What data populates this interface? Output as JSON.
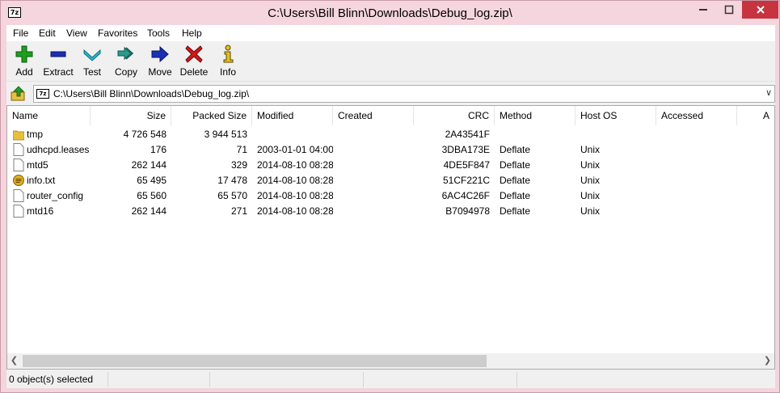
{
  "window": {
    "title": "C:\\Users\\Bill Blinn\\Downloads\\Debug_log.zip\\",
    "app_icon_text": "7z"
  },
  "window_controls": {
    "minimize": "▭",
    "maximize": "☐",
    "close": "✕"
  },
  "menu": [
    "File",
    "Edit",
    "View",
    "Favorites",
    "Tools",
    "Help"
  ],
  "toolbar": [
    {
      "label": "Add",
      "icon": "plus-icon",
      "color": "#1e9e1e"
    },
    {
      "label": "Extract",
      "icon": "minus-icon",
      "color": "#1a2fb5"
    },
    {
      "label": "Test",
      "icon": "check-chevron-icon",
      "color": "#2ab5c9"
    },
    {
      "label": "Copy",
      "icon": "double-arrow-icon",
      "color": "#2a9a8a"
    },
    {
      "label": "Move",
      "icon": "right-arrow-icon",
      "color": "#1a2fb5"
    },
    {
      "label": "Delete",
      "icon": "x-icon",
      "color": "#d01818"
    },
    {
      "label": "Info",
      "icon": "info-icon",
      "color": "#e0c020"
    }
  ],
  "address": {
    "path": "C:\\Users\\Bill Blinn\\Downloads\\Debug_log.zip\\",
    "icon_text": "7z"
  },
  "columns": [
    "Name",
    "Size",
    "Packed Size",
    "Modified",
    "Created",
    "CRC",
    "Method",
    "Host OS",
    "Accessed",
    "A"
  ],
  "rows": [
    {
      "icon": "folder-icon",
      "name": "tmp",
      "size": "4 726 548",
      "packed": "3 944 513",
      "modified": "",
      "created": "",
      "crc": "2A43541F",
      "method": "",
      "host": ""
    },
    {
      "icon": "file-icon",
      "name": "udhcpd.leases",
      "size": "176",
      "packed": "71",
      "modified": "2003-01-01 04:00",
      "created": "",
      "crc": "3DBA173E",
      "method": "Deflate",
      "host": "Unix"
    },
    {
      "icon": "file-icon",
      "name": "mtd5",
      "size": "262 144",
      "packed": "329",
      "modified": "2014-08-10 08:28",
      "created": "",
      "crc": "4DE5F847",
      "method": "Deflate",
      "host": "Unix"
    },
    {
      "icon": "text-file-icon",
      "name": "info.txt",
      "size": "65 495",
      "packed": "17 478",
      "modified": "2014-08-10 08:28",
      "created": "",
      "crc": "51CF221C",
      "method": "Deflate",
      "host": "Unix"
    },
    {
      "icon": "file-icon",
      "name": "router_config",
      "size": "65 560",
      "packed": "65 570",
      "modified": "2014-08-10 08:28",
      "created": "",
      "crc": "6AC4C26F",
      "method": "Deflate",
      "host": "Unix"
    },
    {
      "icon": "file-icon",
      "name": "mtd16",
      "size": "262 144",
      "packed": "271",
      "modified": "2014-08-10 08:28",
      "created": "",
      "crc": "B7094978",
      "method": "Deflate",
      "host": "Unix"
    }
  ],
  "status": {
    "selected": "0 object(s) selected"
  },
  "colors": {
    "titlebar": "#f5d5de",
    "close": "#c7333f"
  }
}
